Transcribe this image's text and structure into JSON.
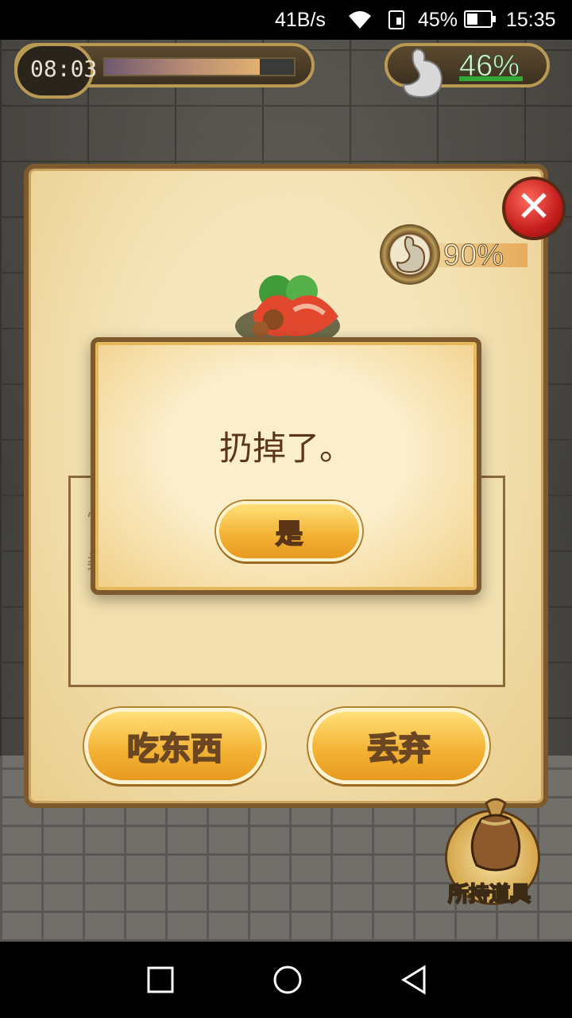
{
  "status_bar": {
    "net_speed": "41B/s",
    "battery_percent": "45%",
    "battery_level": 0.45,
    "time": "15:35"
  },
  "hud": {
    "game_time": "08:03",
    "time_bar_level": 0.82,
    "stomach_percent": "46%"
  },
  "item_panel": {
    "stomach_percent": "90%",
    "description_fragments": [
      "忄",
      "柔"
    ],
    "eat_button": "吃东西",
    "discard_button": "丢弃",
    "inventory_button": "所持道具"
  },
  "dialog": {
    "message": "扔掉了。",
    "confirm_button": "是"
  },
  "colors": {
    "parchment": "#f5e6bb",
    "button_gold": "#f4b436",
    "close_red": "#c51d1d",
    "text_brown": "#5a3517"
  },
  "icons": {
    "hud_clock": "clock-icon",
    "hud_stomach": "stomach-icon",
    "close": "close-icon",
    "food": "food-platter-icon",
    "bag": "bag-icon"
  }
}
